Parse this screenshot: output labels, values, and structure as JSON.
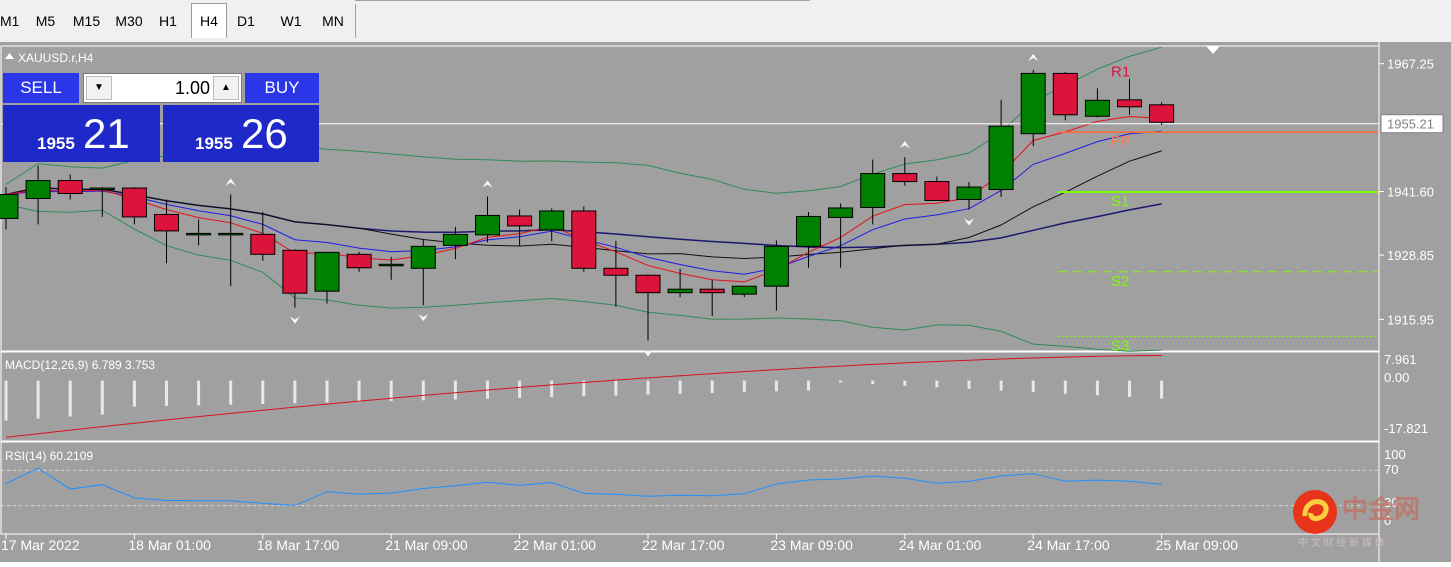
{
  "timeframes": [
    "M1",
    "M5",
    "M15",
    "M30",
    "H1",
    "H4",
    "D1",
    "W1",
    "MN"
  ],
  "active_timeframe": "H4",
  "chart": {
    "symbol_label": "XAUUSD.r,H4",
    "price_labels": [
      "1967.25",
      "1955.21",
      "1941.60",
      "1928.85",
      "1915.95"
    ],
    "current_price": "1955.21",
    "time_labels": [
      "17 Mar 2022",
      "18 Mar 01:00",
      "18 Mar 17:00",
      "21 Mar 09:00",
      "22 Mar 01:00",
      "22 Mar 17:00",
      "23 Mar 09:00",
      "24 Mar 01:00",
      "24 Mar 17:00",
      "25 Mar 09:00"
    ],
    "pivot_labels": {
      "r1": "R1",
      "pp": "PP",
      "s1": "S1",
      "s2": "S2",
      "s3": "S3"
    }
  },
  "trade_panel": {
    "sell_label": "SELL",
    "buy_label": "BUY",
    "lot": "1.00",
    "sell_small": "1955",
    "sell_big": "21",
    "buy_small": "1955",
    "buy_big": "26"
  },
  "macd": {
    "label": "MACD(12,26,9) 6.789 3.753",
    "scale": [
      "7.961",
      "0.00",
      "-17.821"
    ]
  },
  "rsi": {
    "label": "RSI(14) 60.2109",
    "scale": [
      "100",
      "70",
      "30",
      "0"
    ]
  },
  "watermark": {
    "title": "中金网",
    "subtitle": "中 文 财 经 新 媒 体"
  },
  "colors": {
    "chart_bg": "#a0a0a0",
    "bull": "#008000",
    "bear": "#dc143c",
    "panel_blue": "#2a36e8"
  },
  "chart_data": {
    "type": "candlestick",
    "timeframe": "H4",
    "candles": [
      {
        "o": 1936.2,
        "h": 1942.5,
        "l": 1934.0,
        "c": 1941.0
      },
      {
        "o": 1940.2,
        "h": 1946.8,
        "l": 1935.0,
        "c": 1943.8
      },
      {
        "o": 1943.8,
        "h": 1945.0,
        "l": 1940.0,
        "c": 1941.2
      },
      {
        "o": 1942.3,
        "h": 1942.5,
        "l": 1936.5,
        "c": 1942.3
      },
      {
        "o": 1942.3,
        "h": 1942.5,
        "l": 1935.0,
        "c": 1936.5
      },
      {
        "o": 1937.0,
        "h": 1940.0,
        "l": 1927.2,
        "c": 1933.7
      },
      {
        "o": 1933.2,
        "h": 1936.0,
        "l": 1930.8,
        "c": 1933.2
      },
      {
        "o": 1933.2,
        "h": 1941.0,
        "l": 1922.6,
        "c": 1933.2
      },
      {
        "o": 1933.0,
        "h": 1937.5,
        "l": 1927.7,
        "c": 1929.0
      },
      {
        "o": 1929.8,
        "h": 1930.0,
        "l": 1918.3,
        "c": 1921.2
      },
      {
        "o": 1921.6,
        "h": 1929.4,
        "l": 1919.1,
        "c": 1929.4
      },
      {
        "o": 1929.0,
        "h": 1929.5,
        "l": 1925.5,
        "c": 1926.3
      },
      {
        "o": 1927.0,
        "h": 1928.5,
        "l": 1923.9,
        "c": 1927.0
      },
      {
        "o": 1926.2,
        "h": 1932.0,
        "l": 1918.8,
        "c": 1930.6
      },
      {
        "o": 1930.8,
        "h": 1934.5,
        "l": 1928.0,
        "c": 1933.0
      },
      {
        "o": 1932.9,
        "h": 1940.6,
        "l": 1931.4,
        "c": 1936.8
      },
      {
        "o": 1936.7,
        "h": 1938.0,
        "l": 1930.7,
        "c": 1934.7
      },
      {
        "o": 1933.9,
        "h": 1938.2,
        "l": 1931.6,
        "c": 1937.7
      },
      {
        "o": 1937.7,
        "h": 1938.6,
        "l": 1925.5,
        "c": 1926.2
      },
      {
        "o": 1926.2,
        "h": 1931.7,
        "l": 1918.5,
        "c": 1924.8
      },
      {
        "o": 1924.8,
        "h": 1925.0,
        "l": 1911.7,
        "c": 1921.3
      },
      {
        "o": 1921.3,
        "h": 1926.1,
        "l": 1920.4,
        "c": 1922.0
      },
      {
        "o": 1922.0,
        "h": 1923.8,
        "l": 1916.6,
        "c": 1921.3
      },
      {
        "o": 1921.0,
        "h": 1922.0,
        "l": 1920.4,
        "c": 1922.6
      },
      {
        "o": 1922.6,
        "h": 1931.8,
        "l": 1917.7,
        "c": 1930.6
      },
      {
        "o": 1930.6,
        "h": 1937.5,
        "l": 1926.3,
        "c": 1936.6
      },
      {
        "o": 1936.4,
        "h": 1939.2,
        "l": 1926.3,
        "c": 1938.3
      },
      {
        "o": 1938.4,
        "h": 1948.0,
        "l": 1935.0,
        "c": 1945.2
      },
      {
        "o": 1945.2,
        "h": 1948.5,
        "l": 1942.8,
        "c": 1943.6
      },
      {
        "o": 1943.6,
        "h": 1944.6,
        "l": 1940.0,
        "c": 1939.8
      },
      {
        "o": 1940.0,
        "h": 1943.5,
        "l": 1938.0,
        "c": 1942.5
      },
      {
        "o": 1942.0,
        "h": 1960.0,
        "l": 1940.5,
        "c": 1954.7
      },
      {
        "o": 1953.2,
        "h": 1966.0,
        "l": 1950.7,
        "c": 1965.3
      },
      {
        "o": 1965.3,
        "h": 1965.6,
        "l": 1955.9,
        "c": 1957.0
      },
      {
        "o": 1956.7,
        "h": 1962.3,
        "l": 1956.5,
        "c": 1959.9
      },
      {
        "o": 1960.0,
        "h": 1964.2,
        "l": 1957.0,
        "c": 1958.6
      },
      {
        "o": 1959.0,
        "h": 1959.5,
        "l": 1955.0,
        "c": 1955.5
      }
    ],
    "pivots": {
      "R1": 1967.5,
      "PP": 1953.5,
      "S1": 1941.5,
      "S2": 1925.5,
      "S3": 1912.5
    },
    "price_range": [
      1909.6,
      1970.8
    ],
    "price_ticks": [
      1967.25,
      1955.21,
      1941.6,
      1928.85,
      1915.95
    ],
    "macd_range": [
      -17.821,
      7.961
    ],
    "rsi_levels": [
      70,
      30
    ]
  }
}
